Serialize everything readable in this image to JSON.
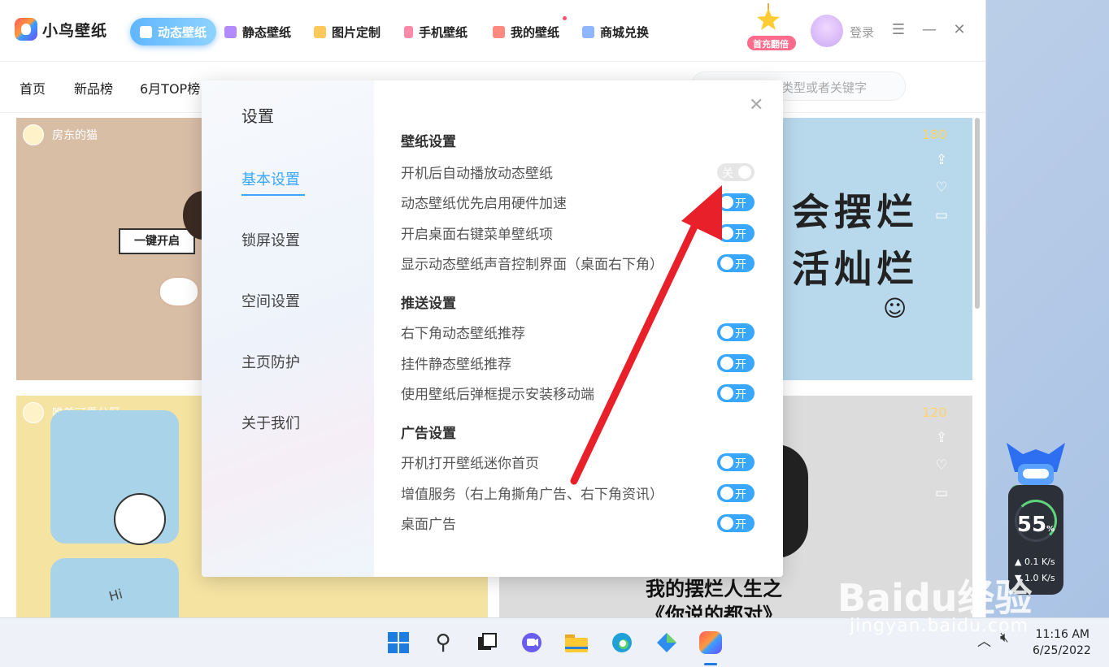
{
  "app": {
    "name": "小鸟壁纸",
    "nav_tabs": [
      {
        "label": "动态壁纸",
        "icon": "play-icon",
        "color": "#ff7a9a"
      },
      {
        "label": "静态壁纸",
        "icon": "image-icon",
        "color": "#b28cff"
      },
      {
        "label": "图片定制",
        "icon": "diy-icon",
        "color": "#ffc85a"
      },
      {
        "label": "手机壁纸",
        "icon": "phone-icon",
        "color": "#ff8aa8"
      },
      {
        "label": "我的壁纸",
        "icon": "user-icon",
        "color": "#ff8a80"
      },
      {
        "label": "商城兑换",
        "icon": "shop-icon",
        "color": "#8fb6ff"
      }
    ],
    "promo_label": "首充翻倍",
    "login_label": "登录",
    "subnav": [
      "首页",
      "新品榜",
      "6月TOP榜"
    ],
    "search_placeholder": "类型或者关键字",
    "cards": [
      {
        "author": "房东的猫",
        "banner": "一键开启"
      },
      {
        "price": "180",
        "text_lines": [
          "会摆烂",
          "活灿烂"
        ]
      },
      {
        "author": "唯美可爱分区",
        "hi": "Hi"
      },
      {
        "price": "120",
        "caption_lines": [
          "我的摆烂人生之",
          "《你说的都对》"
        ]
      }
    ]
  },
  "settings": {
    "title": "设置",
    "sidebar": [
      "基本设置",
      "锁屏设置",
      "空间设置",
      "主页防护",
      "关于我们"
    ],
    "active_sidebar": "基本设置",
    "sections": [
      {
        "title": "壁纸设置",
        "options": [
          {
            "label": "开机后自动播放动态壁纸",
            "state": "关"
          },
          {
            "label": "动态壁纸优先启用硬件加速",
            "state": "开"
          },
          {
            "label": "开启桌面右键菜单壁纸项",
            "state": "开"
          },
          {
            "label": "显示动态壁纸声音控制界面（桌面右下角）",
            "state": "开"
          }
        ]
      },
      {
        "title": "推送设置",
        "options": [
          {
            "label": "右下角动态壁纸推荐",
            "state": "开"
          },
          {
            "label": "挂件静态壁纸推荐",
            "state": "开"
          },
          {
            "label": "使用壁纸后弹框提示安装移动端",
            "state": "开"
          }
        ]
      },
      {
        "title": "广告设置",
        "options": [
          {
            "label": "开机打开壁纸迷你首页",
            "state": "开"
          },
          {
            "label": "增值服务（右上角撕角广告、右下角资讯）",
            "state": "开"
          },
          {
            "label": "桌面广告",
            "state": "开"
          }
        ]
      }
    ]
  },
  "widget": {
    "percent": "55",
    "unit": "%",
    "up": "0.1",
    "down": "1.0",
    "rate_unit": "K/s"
  },
  "taskbar": {
    "time": "11:16 AM",
    "date": "6/25/2022"
  },
  "watermark": {
    "brand": "Baidu经验",
    "url": "jingyan.baidu.com"
  },
  "colors": {
    "accent": "#3aa7ff",
    "arrow": "#e8202a"
  }
}
